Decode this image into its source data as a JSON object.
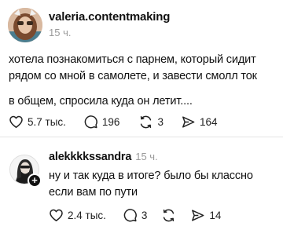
{
  "post": {
    "author": "valeria.contentmaking",
    "time": "15 ч.",
    "text_1": "хотела познакомиться с парнем, который сидит рядом со мной в самолете, и завести смолл ток",
    "text_2": "в общем, спросила куда он летит....",
    "likes": "5.7 тыс.",
    "comments": "196",
    "reposts": "3",
    "shares": "164"
  },
  "reply": {
    "author": "alekkkkssandra",
    "time": "15 ч.",
    "text": "ну и так куда в итоге? было бы классно если вам по пути",
    "likes": "2.4 тыс.",
    "comments": "3",
    "shares": "14"
  },
  "icons": [
    "heart-icon",
    "comment-icon",
    "repost-icon",
    "share-icon",
    "plus-icon"
  ],
  "colors": {
    "text": "#111111",
    "muted": "#9a9a9a",
    "divider": "#e4e4e4"
  }
}
